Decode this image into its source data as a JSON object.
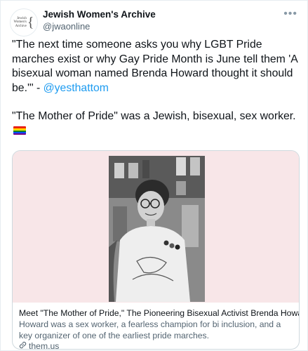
{
  "account": {
    "name": "Jewish Women's Archive",
    "handle": "@jwaonline",
    "logo_text": [
      "Jewish",
      "Women's",
      "Archive"
    ]
  },
  "menu": {
    "label": "more-options"
  },
  "tweet": {
    "paragraph1_text": "\"The next time someone asks you why LGBT Pride marches exist or why Gay Pride Month is June tell them 'A bisexual woman named Brenda Howard thought it should be.'\" - ",
    "paragraph1_mention": "@yesthattom",
    "paragraph2_text": "\"The Mother of Pride\" was a Jewish, bisexual, sex worker. "
  },
  "link_card": {
    "title": "Meet \"The Mother of Pride,\" The Pioneering Bisexual Activist Brenda Howard",
    "description": "Howard was a sex worker, a fearless champion for bi inclusion, and a key organizer of one of the earliest pride marches.",
    "domain": "them.us"
  },
  "colors": {
    "accent": "#1d9bf0",
    "media_background": "#f8e6e8",
    "text_secondary": "#536471"
  },
  "icons": {
    "menu": "more-dots-icon",
    "flag": "rainbow-flag-icon",
    "link": "link-icon"
  }
}
